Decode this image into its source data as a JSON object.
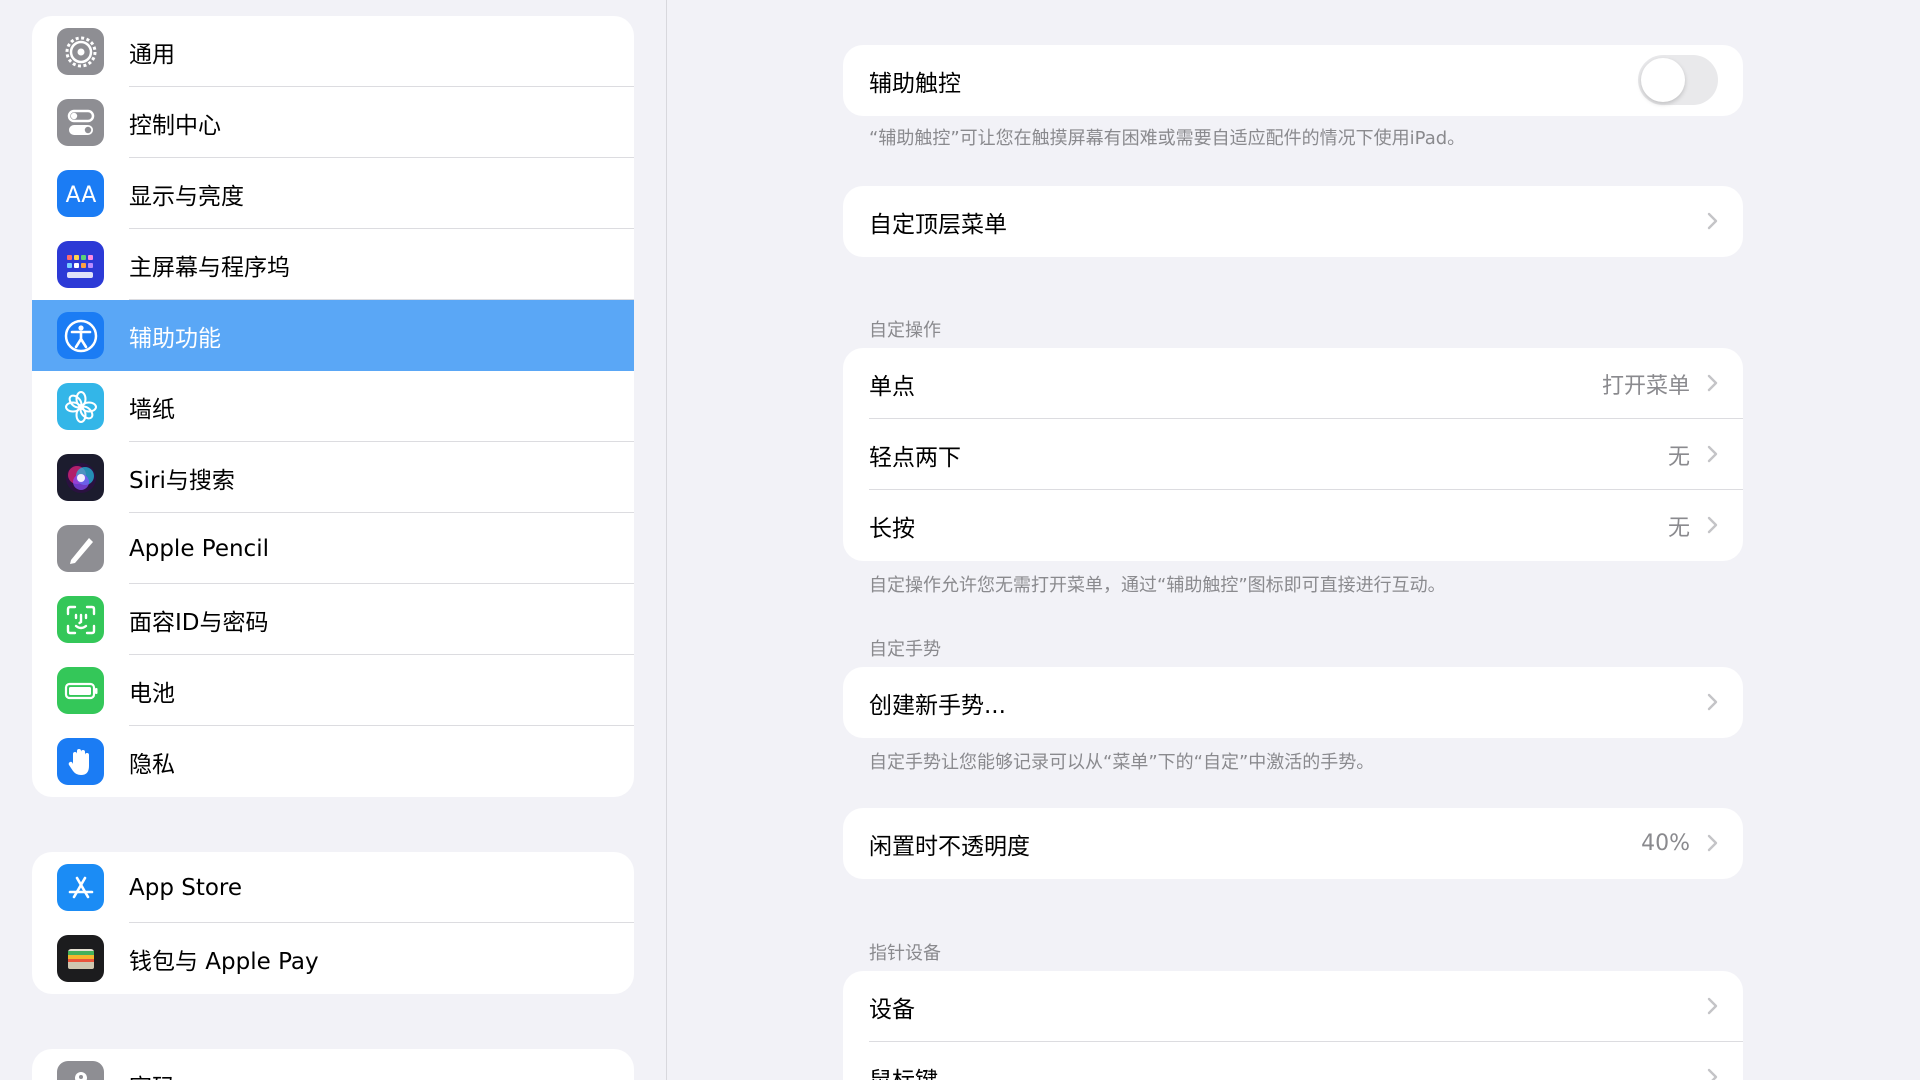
{
  "sidebar": {
    "group1": [
      {
        "label": "通用",
        "icon": "gear-icon",
        "color": "#8e8e93"
      },
      {
        "label": "控制中心",
        "icon": "toggles-icon",
        "color": "#8e8e93"
      },
      {
        "label": "显示与亮度",
        "icon": "text-size-icon",
        "color": "#1b7cf4"
      },
      {
        "label": "主屏幕与程序坞",
        "icon": "home-grid-icon",
        "color": "#2c3ad6"
      },
      {
        "label": "辅助功能",
        "icon": "accessibility-icon",
        "color": "#1b7cf4",
        "selected": true
      },
      {
        "label": "墙纸",
        "icon": "flower-icon",
        "color": "#33b6e8"
      },
      {
        "label": "Siri与搜索",
        "icon": "siri-icon",
        "color": "#1c1c2e"
      },
      {
        "label": "Apple Pencil",
        "icon": "pencil-icon",
        "color": "#8e8e93"
      },
      {
        "label": "面容ID与密码",
        "icon": "face-id-icon",
        "color": "#34c759"
      },
      {
        "label": "电池",
        "icon": "battery-icon",
        "color": "#34c759"
      },
      {
        "label": "隐私",
        "icon": "hand-icon",
        "color": "#1b7cf4"
      }
    ],
    "group2": [
      {
        "label": "App Store",
        "icon": "app-store-icon",
        "color": "#1b8cf5"
      },
      {
        "label": "钱包与 Apple Pay",
        "icon": "wallet-icon",
        "color": "#1c1c1e"
      }
    ],
    "group3": [
      {
        "label": "密码",
        "icon": "key-icon",
        "color": "#8e8e93"
      }
    ]
  },
  "main": {
    "assistive_touch": {
      "label": "辅助触控",
      "toggle_on": false,
      "footer": "“辅助触控”可让您在触摸屏幕有困难或需要自适应配件的情况下使用iPad。"
    },
    "customize_menu": {
      "label": "自定顶层菜单"
    },
    "custom_actions": {
      "header": "自定操作",
      "rows": [
        {
          "label": "单点",
          "value": "打开菜单"
        },
        {
          "label": "轻点两下",
          "value": "无"
        },
        {
          "label": "长按",
          "value": "无"
        }
      ],
      "footer": "自定操作允许您无需打开菜单，通过“辅助触控”图标即可直接进行互动。"
    },
    "custom_gestures": {
      "header": "自定手势",
      "create_label": "创建新手势...",
      "footer": "自定手势让您能够记录可以从“菜单”下的“自定”中激活的手势。"
    },
    "idle_opacity": {
      "label": "闲置时不透明度",
      "value": "40%"
    },
    "pointer_devices": {
      "header": "指针设备",
      "rows": [
        {
          "label": "设备"
        },
        {
          "label": "鼠标键"
        }
      ]
    }
  },
  "colors": {
    "selected_bg": "#5aa7f6",
    "page_bg": "#f2f2f7",
    "secondary_text": "#8a8a8e"
  }
}
